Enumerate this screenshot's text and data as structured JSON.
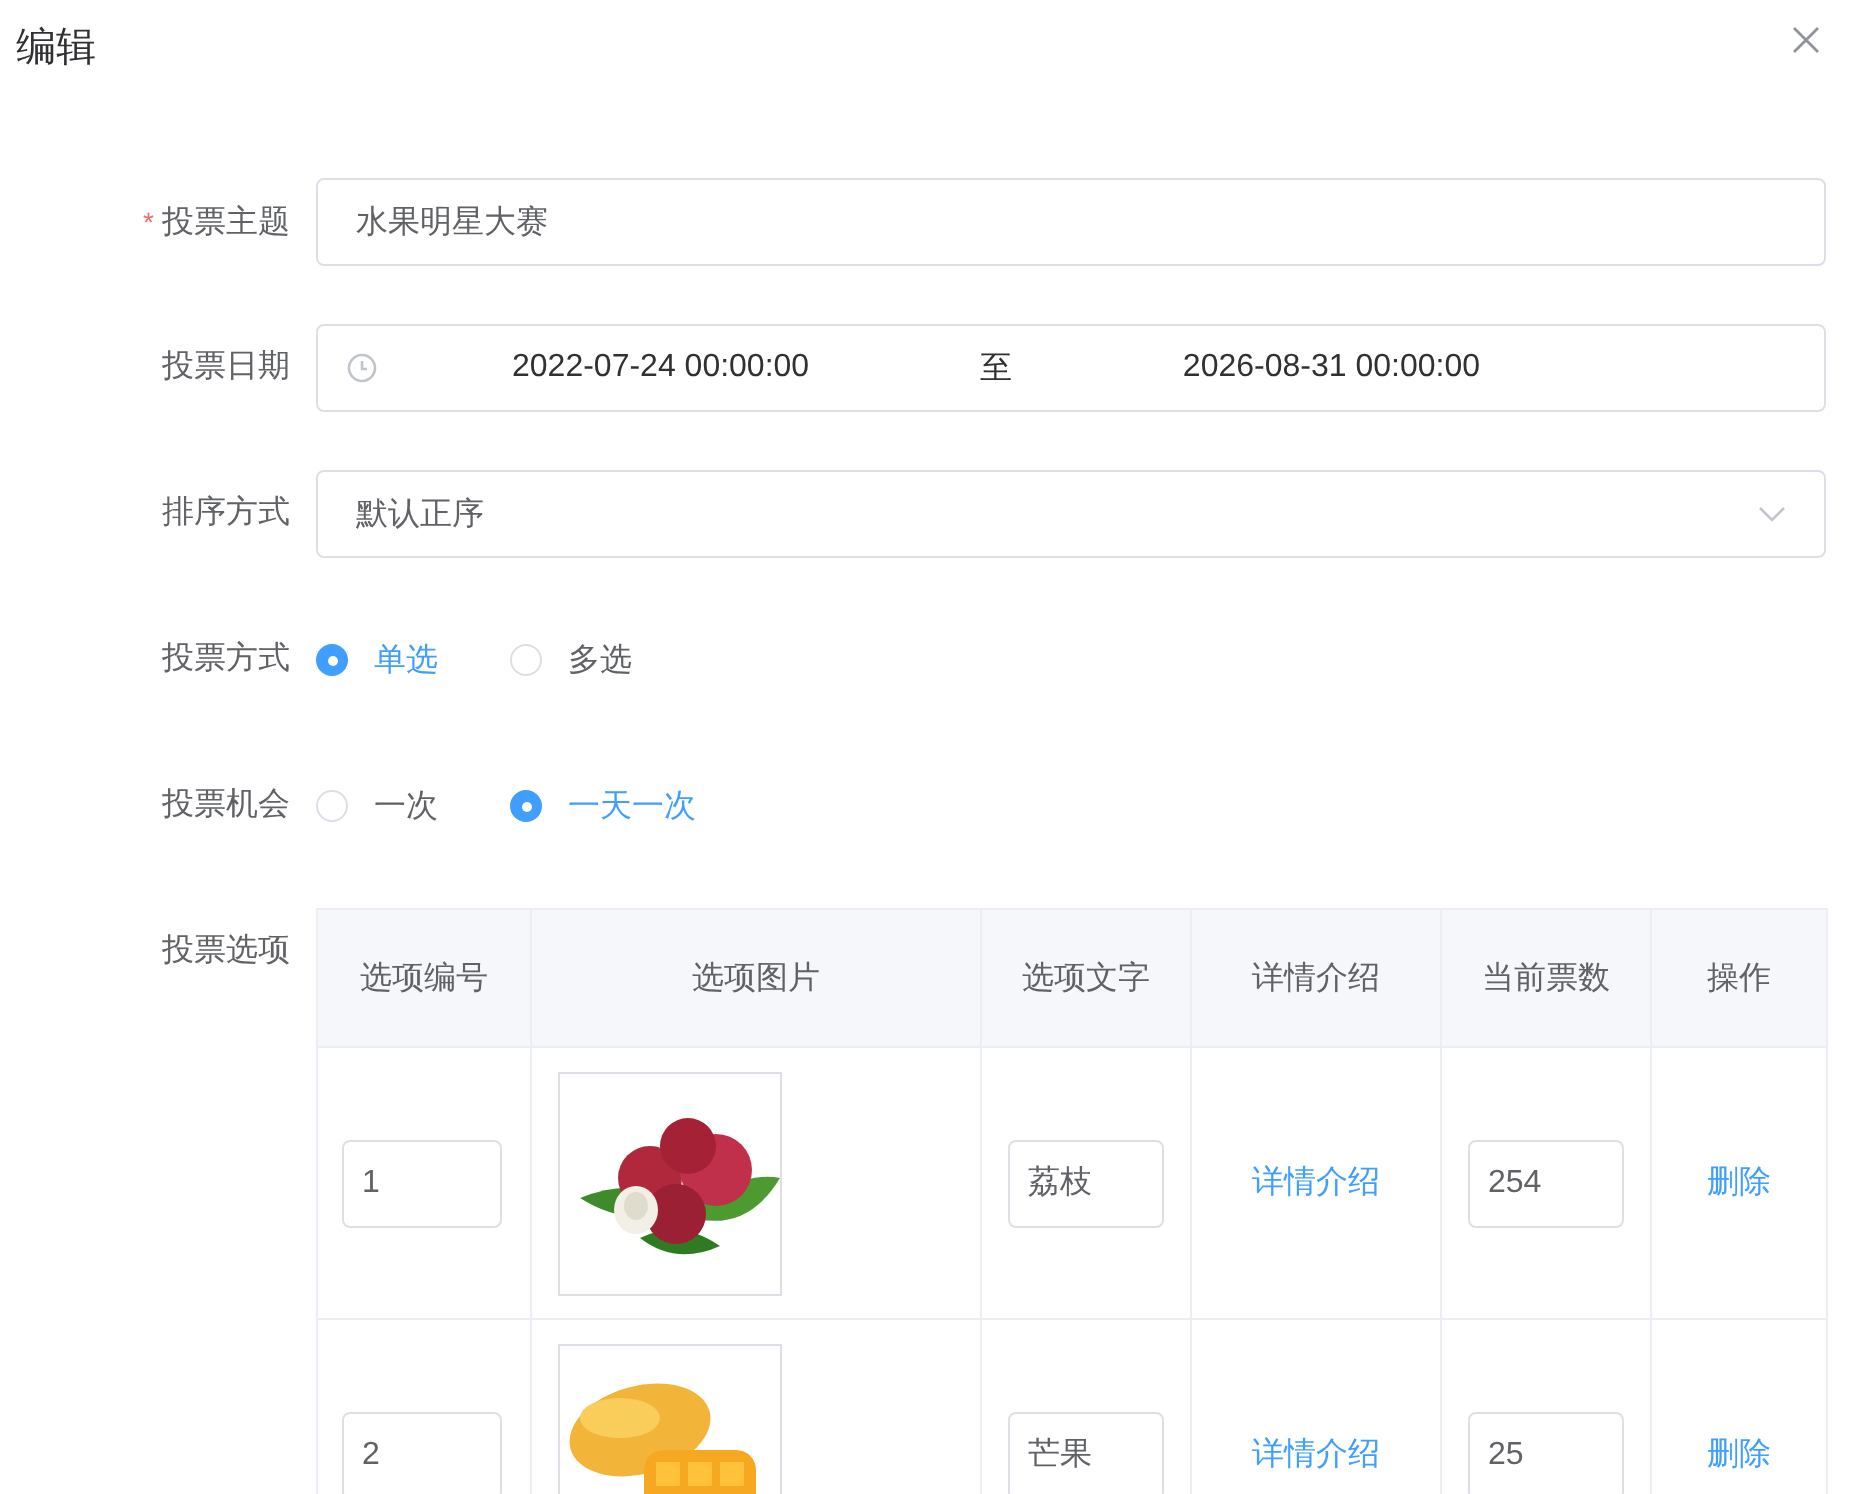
{
  "dialog": {
    "title": "编辑"
  },
  "subject": {
    "label": "投票主题",
    "required_mark": "*",
    "value": "水果明星大赛"
  },
  "date": {
    "label": "投票日期",
    "start": "2022-07-24 00:00:00",
    "separator": "至",
    "end": "2026-08-31 00:00:00"
  },
  "sort": {
    "label": "排序方式",
    "value": "默认正序"
  },
  "vote_mode": {
    "label": "投票方式",
    "options": [
      {
        "label": "单选",
        "selected": true
      },
      {
        "label": "多选",
        "selected": false
      }
    ]
  },
  "vote_chance": {
    "label": "投票机会",
    "options": [
      {
        "label": "一次",
        "selected": false
      },
      {
        "label": "一天一次",
        "selected": true
      }
    ]
  },
  "options_table": {
    "label": "投票选项",
    "columns": [
      "选项编号",
      "选项图片",
      "选项文字",
      "详情介绍",
      "当前票数",
      "操作"
    ],
    "rows": [
      {
        "number": "1",
        "text": "荔枝",
        "detail": "详情介绍",
        "votes": "254",
        "action": "删除"
      },
      {
        "number": "2",
        "text": "芒果",
        "detail": "详情介绍",
        "votes": "25",
        "action": "删除"
      }
    ]
  }
}
